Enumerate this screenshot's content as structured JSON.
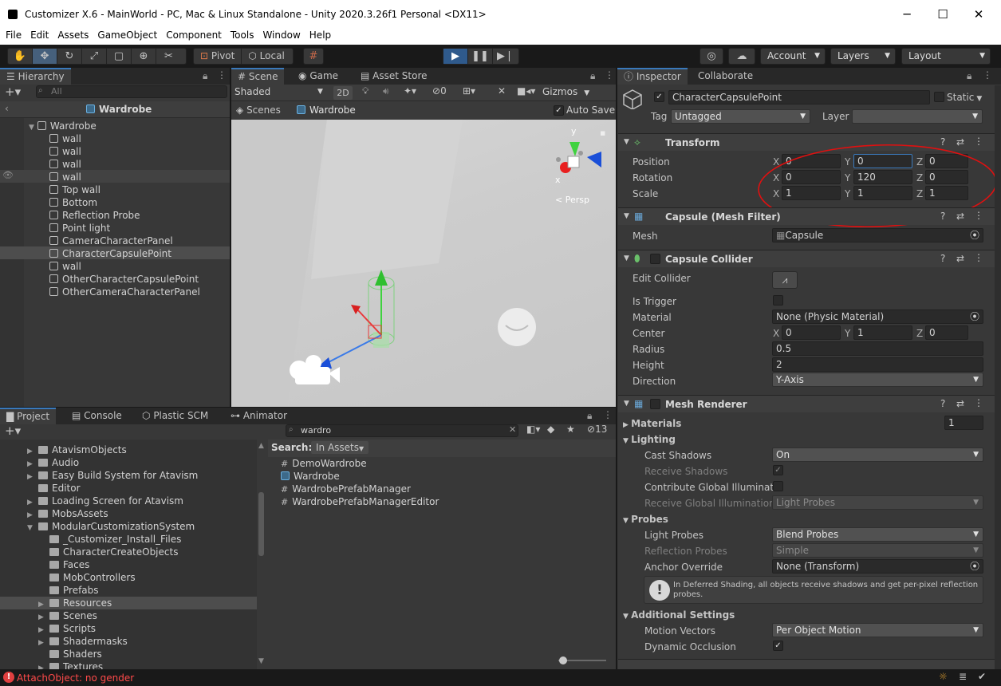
{
  "window": {
    "title": "Customizer X.6 - MainWorld - PC, Mac & Linux Standalone - Unity 2020.3.26f1 Personal <DX11>",
    "minimize": "─",
    "maximize": "☐",
    "close": "✕"
  },
  "menu": [
    "File",
    "Edit",
    "Assets",
    "GameObject",
    "Component",
    "Tools",
    "Window",
    "Help"
  ],
  "toolbar": {
    "pivot": "Pivot",
    "local": "Local",
    "account": "Account",
    "layers": "Layers",
    "layout": "Layout"
  },
  "hierarchy": {
    "tab": "Hierarchy",
    "search_placeholder": "All",
    "scene": "Wardrobe",
    "root": "Wardrobe",
    "items": [
      "wall",
      "wall",
      "wall",
      "wall",
      "Top wall",
      "Bottom",
      "Reflection Probe",
      "Point light",
      "CameraCharacterPanel",
      "CharacterCapsulePoint",
      "wall",
      "OtherCharacterCapsulePoint",
      "OtherCameraCharacterPanel"
    ]
  },
  "scene": {
    "tabs": [
      "Scene",
      "Game",
      "Asset Store"
    ],
    "shading": "Shaded",
    "mode2d": "2D",
    "hidden_count": "0",
    "gizmos": "Gizmos",
    "breadcrumb_root": "Scenes",
    "breadcrumb_scene": "Wardrobe",
    "autosave": "Auto Save",
    "persp": "< Persp",
    "axis_y": "y",
    "axis_x": "x"
  },
  "project": {
    "tabs": [
      "Project",
      "Console",
      "Plastic SCM",
      "Animator"
    ],
    "search_value": "wardro",
    "count": "13",
    "search_label": "Search:",
    "search_scope": "In Assets",
    "folders": [
      {
        "name": "AtavismObjects",
        "indent": 0,
        "tri": true
      },
      {
        "name": "Audio",
        "indent": 0,
        "tri": true
      },
      {
        "name": "Easy Build System for Atavism",
        "indent": 0,
        "tri": true
      },
      {
        "name": "Editor",
        "indent": 0,
        "tri": false
      },
      {
        "name": "Loading Screen for Atavism",
        "indent": 0,
        "tri": true
      },
      {
        "name": "MobsAssets",
        "indent": 0,
        "tri": true
      },
      {
        "name": "ModularCustomizationSystem",
        "indent": 0,
        "tri": true,
        "open": true
      },
      {
        "name": "_Customizer_Install_Files",
        "indent": 1,
        "tri": false
      },
      {
        "name": "CharacterCreateObjects",
        "indent": 1,
        "tri": false
      },
      {
        "name": "Faces",
        "indent": 1,
        "tri": false
      },
      {
        "name": "MobControllers",
        "indent": 1,
        "tri": false
      },
      {
        "name": "Prefabs",
        "indent": 1,
        "tri": false
      },
      {
        "name": "Resources",
        "indent": 1,
        "tri": true,
        "sel": true
      },
      {
        "name": "Scenes",
        "indent": 1,
        "tri": true
      },
      {
        "name": "Scripts",
        "indent": 1,
        "tri": true
      },
      {
        "name": "Shadermasks",
        "indent": 1,
        "tri": true
      },
      {
        "name": "Shaders",
        "indent": 1,
        "tri": false
      },
      {
        "name": "Textures",
        "indent": 1,
        "tri": true
      }
    ],
    "results": [
      {
        "icon": "#",
        "name": "DemoWardrobe"
      },
      {
        "icon": "cube",
        "name": "Wardrobe"
      },
      {
        "icon": "#",
        "name": "WardrobePrefabManager"
      },
      {
        "icon": "#",
        "name": "WardrobePrefabManagerEditor"
      }
    ]
  },
  "inspector": {
    "tabs": [
      "Inspector",
      "Collaborate"
    ],
    "object_name": "CharacterCapsulePoint",
    "static": "Static",
    "tag_label": "Tag",
    "tag": "Untagged",
    "layer_label": "Layer",
    "layer": "",
    "transform": {
      "title": "Transform",
      "position_label": "Position",
      "rotation_label": "Rotation",
      "scale_label": "Scale",
      "position": [
        "0",
        "0",
        "0"
      ],
      "rotation": [
        "0",
        "120",
        "0"
      ],
      "scale": [
        "1",
        "1",
        "1"
      ]
    },
    "mesh_filter": {
      "title": "Capsule (Mesh Filter)",
      "mesh_label": "Mesh",
      "mesh": "Capsule"
    },
    "collider": {
      "title": "Capsule Collider",
      "edit_label": "Edit Collider",
      "trigger_label": "Is Trigger",
      "material_label": "Material",
      "material": "None (Physic Material)",
      "center_label": "Center",
      "center": [
        "0",
        "1",
        "0"
      ],
      "radius_label": "Radius",
      "radius": "0.5",
      "height_label": "Height",
      "height": "2",
      "direction_label": "Direction",
      "direction": "Y-Axis"
    },
    "renderer": {
      "title": "Mesh Renderer",
      "materials_label": "Materials",
      "materials_count": "1",
      "lighting": "Lighting",
      "cast_label": "Cast Shadows",
      "cast": "On",
      "receive_label": "Receive Shadows",
      "contribute_label": "Contribute Global Illuminatio",
      "receive_gi_label": "Receive Global Illumination",
      "receive_gi": "Light Probes",
      "probes": "Probes",
      "light_probes_label": "Light Probes",
      "light_probes": "Blend Probes",
      "reflection_label": "Reflection Probes",
      "reflection": "Simple",
      "anchor_label": "Anchor Override",
      "anchor": "None (Transform)",
      "info": "In Deferred Shading, all objects receive shadows and get per-pixel reflection probes.",
      "additional": "Additional Settings",
      "motion_label": "Motion Vectors",
      "motion": "Per Object Motion",
      "occlusion_label": "Dynamic Occlusion"
    }
  },
  "status": {
    "error": "AttachObject: no gender"
  },
  "colors": {
    "accent": "#3a79bb",
    "selection": "#4d4d4d",
    "annotation": "#e01010",
    "error": "#ff4a4a"
  }
}
